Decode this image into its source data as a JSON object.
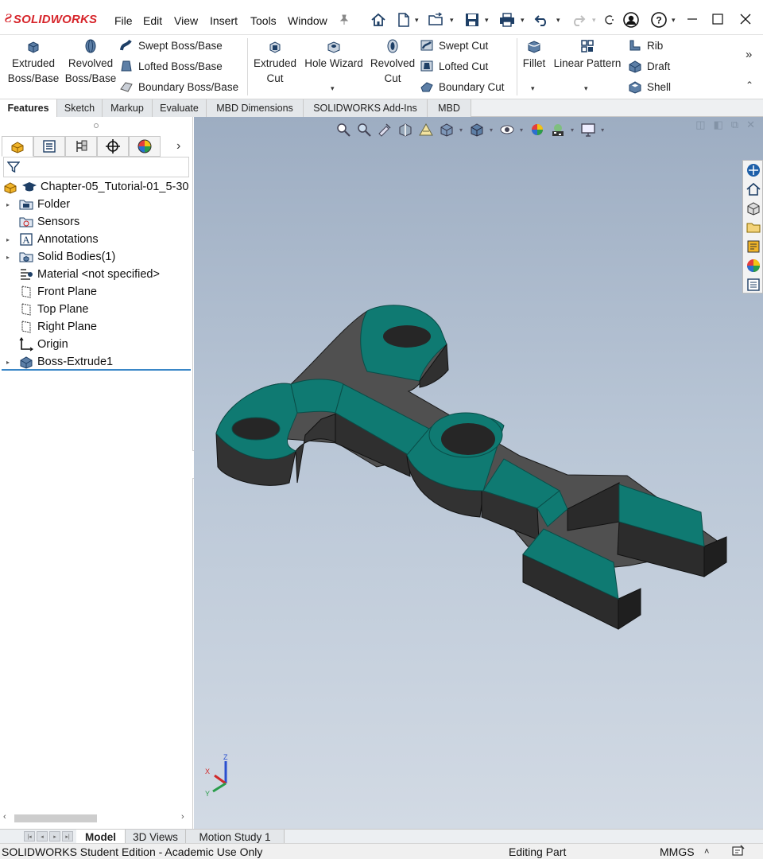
{
  "app": {
    "logo_text": "SOLIDWORKS",
    "brand_color": "#d7262c"
  },
  "menu": {
    "items": [
      "File",
      "Edit",
      "View",
      "Insert",
      "Tools",
      "Window"
    ]
  },
  "ribbon": {
    "extruded_boss": [
      "Extruded",
      "Boss/Base"
    ],
    "revolved_boss": [
      "Revolved",
      "Boss/Base"
    ],
    "swept_boss": "Swept Boss/Base",
    "lofted_boss": "Lofted Boss/Base",
    "boundary_boss": "Boundary Boss/Base",
    "extruded_cut": [
      "Extruded",
      "Cut"
    ],
    "hole_wizard": "Hole Wizard",
    "revolved_cut": [
      "Revolved",
      "Cut"
    ],
    "swept_cut": "Swept Cut",
    "lofted_cut": "Lofted Cut",
    "boundary_cut": "Boundary Cut",
    "fillet": "Fillet",
    "linear_pattern": "Linear Pattern",
    "rib": "Rib",
    "draft": "Draft",
    "shell": "Shell"
  },
  "cm_tabs": [
    "Features",
    "Sketch",
    "Markup",
    "Evaluate",
    "MBD Dimensions",
    "SOLIDWORKS Add-Ins",
    "MBD"
  ],
  "active_cm_tab": "Features",
  "tree": {
    "root": "Chapter-05_Tutorial-01_5-30",
    "items": [
      {
        "label": "Folder",
        "icon": "folder-icon",
        "expandable": true
      },
      {
        "label": "Sensors",
        "icon": "sensors-icon",
        "expandable": false
      },
      {
        "label": "Annotations",
        "icon": "annotations-icon",
        "expandable": true
      },
      {
        "label": "Solid Bodies(1)",
        "icon": "solid-bodies-icon",
        "expandable": true
      },
      {
        "label": "Material <not specified>",
        "icon": "material-icon",
        "expandable": false
      },
      {
        "label": "Front Plane",
        "icon": "plane-icon",
        "expandable": false
      },
      {
        "label": "Top Plane",
        "icon": "plane-icon",
        "expandable": false
      },
      {
        "label": "Right Plane",
        "icon": "plane-icon",
        "expandable": false
      },
      {
        "label": "Origin",
        "icon": "origin-icon",
        "expandable": false
      },
      {
        "label": "Boss-Extrude1",
        "icon": "boss-extrude-icon",
        "expandable": true
      }
    ]
  },
  "triad": {
    "x": "X",
    "y": "Y",
    "z": "Z"
  },
  "bottom_tabs": [
    "Model",
    "3D Views",
    "Motion Study 1"
  ],
  "active_bottom_tab": "Model",
  "status": {
    "left": "SOLIDWORKS Student Edition - Academic Use Only",
    "mode": "Editing Part",
    "units": "MMGS",
    "units_caret": "˄"
  },
  "colors": {
    "face_teal": "#0f7a72",
    "face_dark": "#3c3c3c",
    "viewport_top": "#9dadc2",
    "viewport_bottom": "#d2dae4"
  }
}
